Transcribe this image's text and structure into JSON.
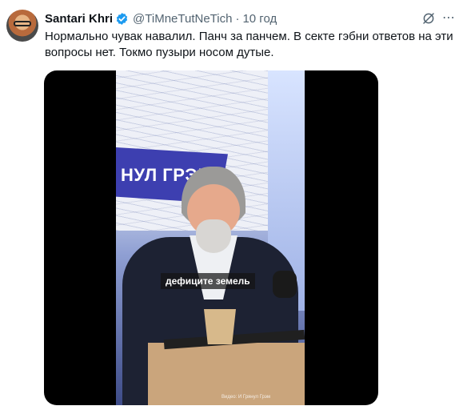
{
  "tweet": {
    "author": {
      "display_name": "Santari Khri",
      "handle": "@TiMneTutNeTich",
      "verified": true
    },
    "separator": "·",
    "time": "10 год",
    "text": "Нормально чувак навалил. Панч за панчем. В секте гэбни ответов на эти вопросы нет. Токмо пузыри носом дутые.",
    "icons": {
      "avatar": "avatar-image",
      "verified": "verified-badge-icon",
      "grok": "grok-icon",
      "more": "more-icon"
    },
    "colors": {
      "verified_blue": "#1d9bf0",
      "secondary_text": "#536471",
      "primary_text": "#0f1419"
    }
  },
  "media": {
    "type": "video",
    "banner_text": "НУЛ ГРЭМ",
    "caption": "дефиците земель",
    "watermark": "Видео: И Грянул Грэм"
  }
}
